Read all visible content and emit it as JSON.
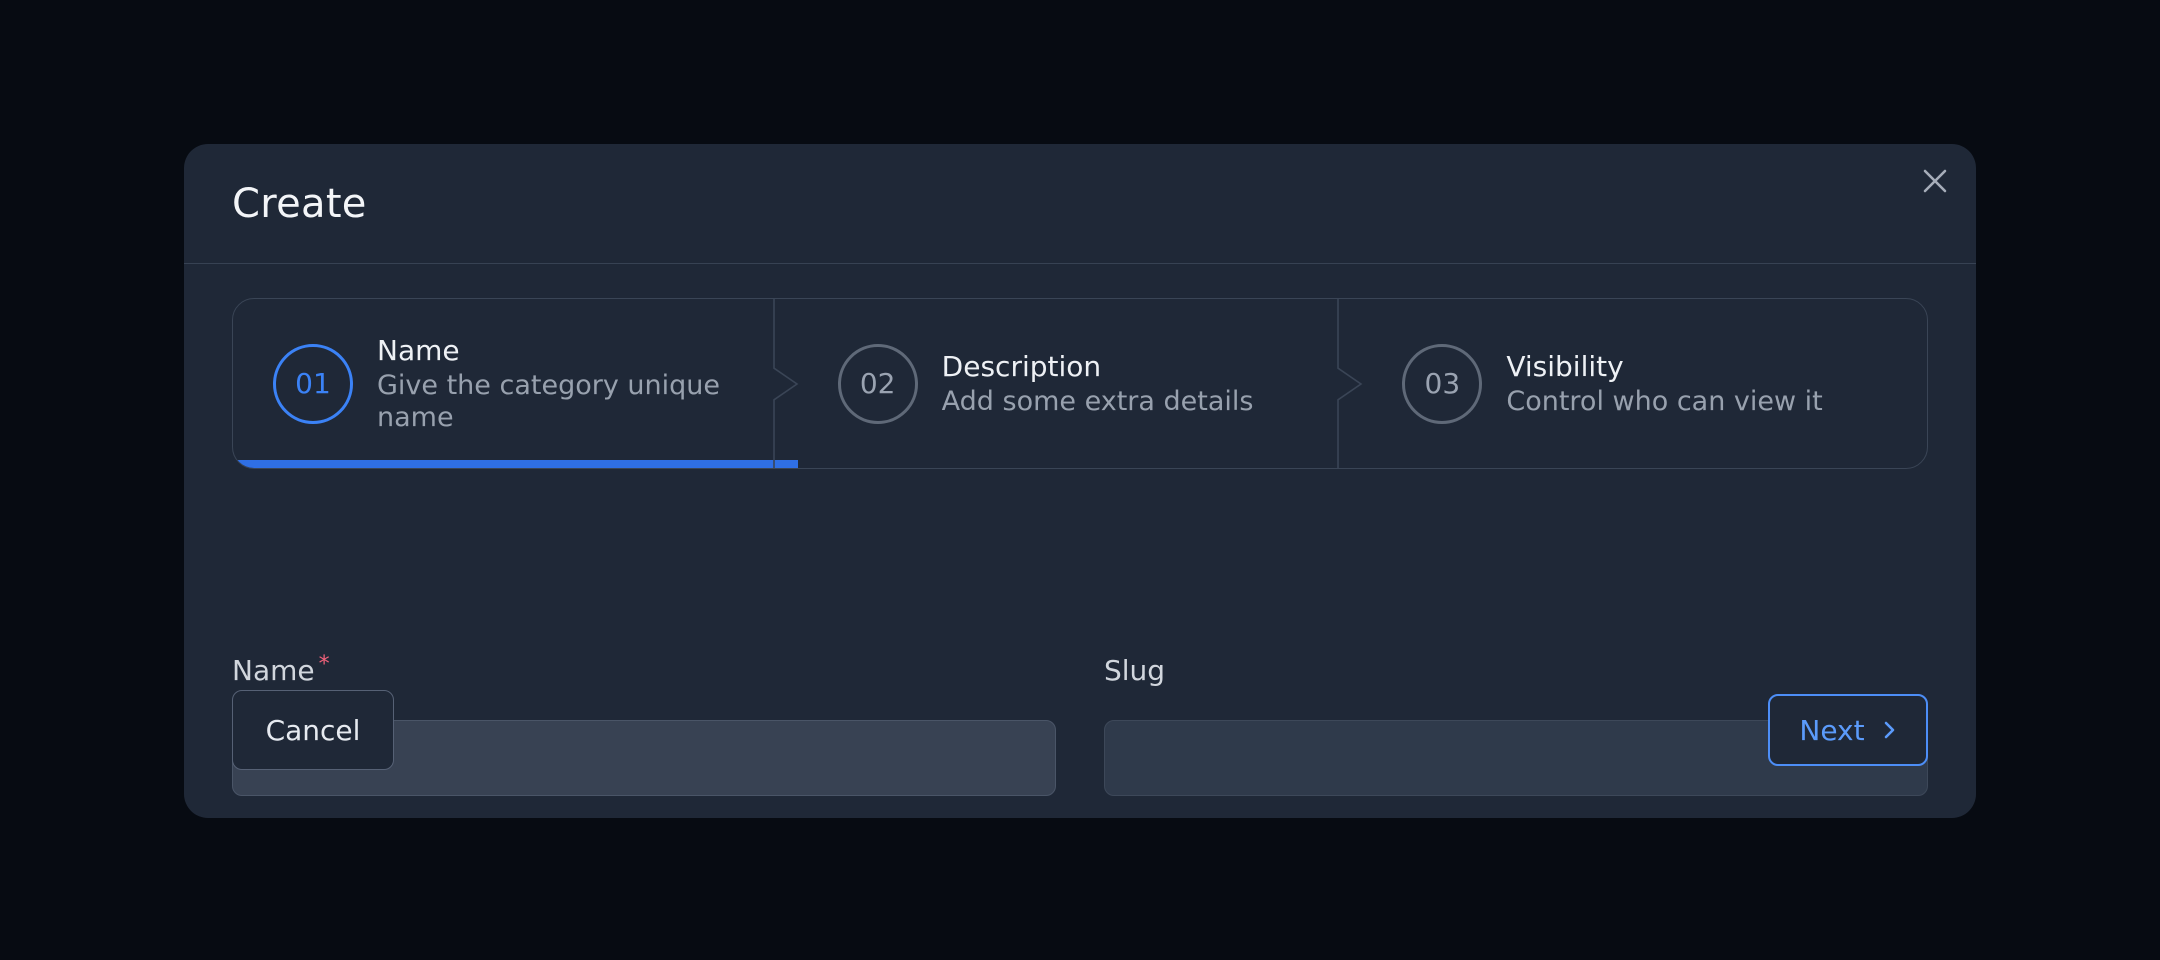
{
  "modal": {
    "title": "Create",
    "close_icon": "close-icon"
  },
  "steps": [
    {
      "number": "01",
      "title": "Name",
      "description": "Give the category unique name",
      "state": "active"
    },
    {
      "number": "02",
      "title": "Description",
      "description": "Add some extra details",
      "state": "upcoming"
    },
    {
      "number": "03",
      "title": "Visibility",
      "description": "Control who can view it",
      "state": "upcoming"
    }
  ],
  "progress": {
    "current_step": 1,
    "total_steps": 3
  },
  "form": {
    "name": {
      "label": "Name",
      "required_marker": "*",
      "value": ""
    },
    "slug": {
      "label": "Slug",
      "value": ""
    }
  },
  "actions": {
    "cancel_label": "Cancel",
    "next_label": "Next",
    "next_icon": "chevron-right-icon"
  },
  "colors": {
    "background": "#070b12",
    "modal": "#1f2837",
    "accent": "#3b82f6",
    "required": "#f0617a"
  }
}
